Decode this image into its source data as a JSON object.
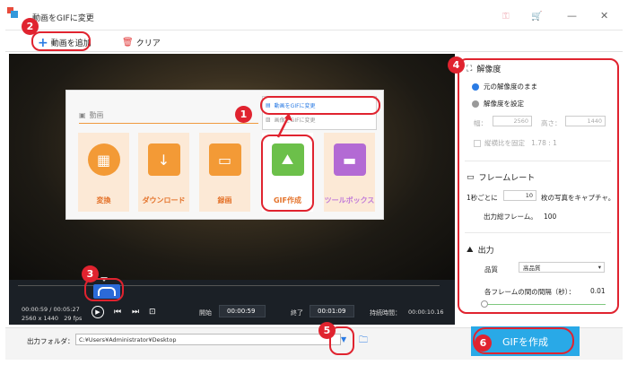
{
  "window": {
    "title": "動画をGIFに変更",
    "icons": [
      "key-icon",
      "cart-icon"
    ],
    "controls": [
      "minimize-icon",
      "close-icon"
    ]
  },
  "toolbar": {
    "add_label": "動画を追加",
    "clear_label": "クリア"
  },
  "overlay": {
    "header": "動画",
    "tiles": [
      {
        "label": "変換",
        "icon": "film-icon",
        "color": "#f39a36"
      },
      {
        "label": "ダウンロード",
        "icon": "download-icon",
        "color": "#f39a36"
      },
      {
        "label": "録画",
        "icon": "monitor-icon",
        "color": "#f39a36"
      },
      {
        "label": "GIF作成",
        "icon": "image-icon",
        "color": "#6cc04a"
      },
      {
        "label": "ツールボックス",
        "icon": "toolbox-icon",
        "color": "#b36ad4"
      }
    ],
    "dropdown": [
      "動画をGIFに変更",
      "画像をGIFに変更"
    ]
  },
  "markers": [
    "1",
    "2",
    "3",
    "4",
    "5",
    "6"
  ],
  "player": {
    "current_time": "00:00:59",
    "total_time": "00:05:27",
    "resolution": "2560 x 1440",
    "fps": "29 fps",
    "start_label": "開始",
    "start_value": "00:00:59",
    "end_label": "終了",
    "end_value": "00:01:09",
    "duration_label": "持続時間：",
    "duration_value": "00:00:10.16"
  },
  "resolution_section": {
    "title": "解像度",
    "option_keep": "元の解像度のまま",
    "option_set": "解像度を設定",
    "width_label": "幅：",
    "width_value": "2560",
    "height_label": "高さ：",
    "height_value": "1440",
    "aspect_label": "縦横比を固定",
    "aspect_value": "1.78 : 1"
  },
  "framerate_section": {
    "title": "フレームレート",
    "per_sec_prefix": "1秒ごとに",
    "per_sec_value": "10",
    "per_sec_suffix": "枚の写真をキャプチャ。",
    "total_label": "出力総フレーム。",
    "total_value": "100"
  },
  "output_section": {
    "title": "出力",
    "quality_label": "品質",
    "quality_value": "高品質",
    "interval_label": "各フレームの間の間隔（秒）：",
    "interval_value": "0.01"
  },
  "bottom": {
    "folder_label": "出力フォルダ：",
    "folder_path": "C:¥Users¥Administrator¥Desktop",
    "create_button": "GIFを作成"
  },
  "colors": {
    "accent": "#e0232f",
    "blue": "#29a9e7",
    "orange": "#f39a36"
  }
}
